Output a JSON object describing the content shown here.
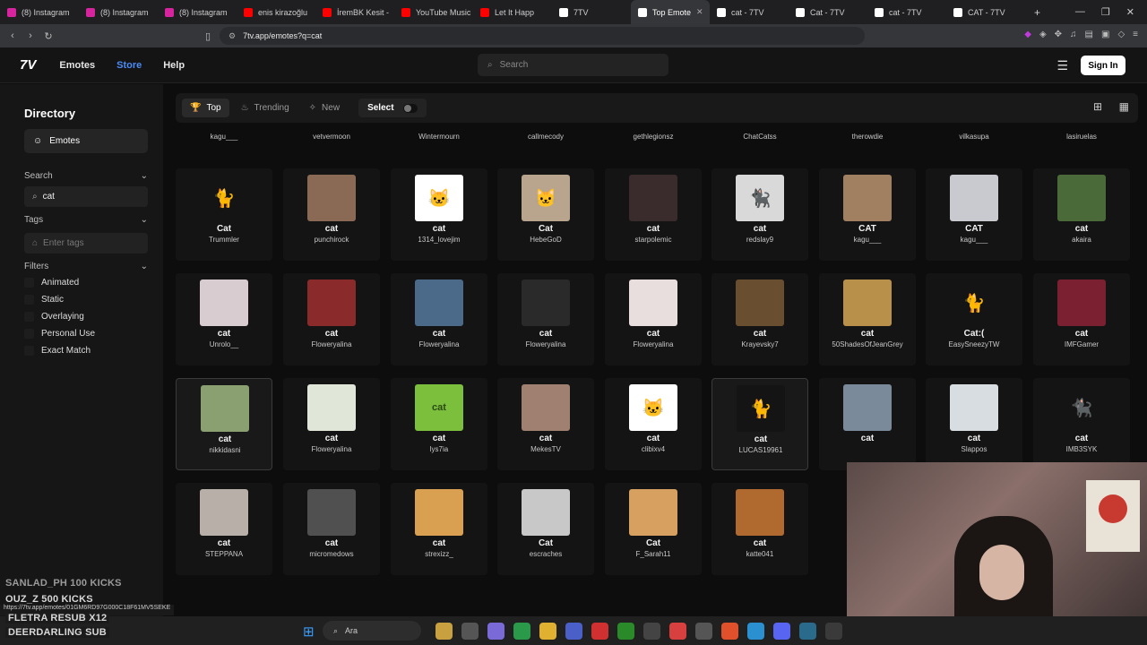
{
  "browser": {
    "tabs": [
      {
        "label": "(8) Instagram",
        "color": "#d6249f"
      },
      {
        "label": "(8) Instagram",
        "color": "#d6249f"
      },
      {
        "label": "(8) Instagram",
        "color": "#d6249f"
      },
      {
        "label": "enis kirazoğlu",
        "color": "#ff0000"
      },
      {
        "label": "İremBK Kesit -",
        "color": "#ff0000"
      },
      {
        "label": "YouTube Music",
        "color": "#ff0000"
      },
      {
        "label": "Let It Happ",
        "color": "#ff0000"
      },
      {
        "label": "7TV",
        "color": "#ffffff"
      },
      {
        "label": "Top Emote",
        "color": "#ffffff",
        "active": true
      },
      {
        "label": "cat - 7TV",
        "color": "#ffffff"
      },
      {
        "label": "Cat - 7TV",
        "color": "#ffffff"
      },
      {
        "label": "cat - 7TV",
        "color": "#ffffff"
      },
      {
        "label": "CAT - 7TV",
        "color": "#ffffff"
      }
    ],
    "url": "7tv.app/emotes?q=cat",
    "status_url": "https://7tv.app/emotes/01GM6RD97G000C18F61MV5SEKE"
  },
  "header": {
    "logo": "7V",
    "nav": [
      "Emotes",
      "Store",
      "Help"
    ],
    "search_placeholder": "Search",
    "sign_in": "Sign In"
  },
  "sidebar": {
    "title": "Directory",
    "emotes_label": "Emotes",
    "search_label": "Search",
    "search_value": "cat",
    "tags_label": "Tags",
    "tags_placeholder": "Enter tags",
    "filters_label": "Filters",
    "filters": [
      "Animated",
      "Static",
      "Overlaying",
      "Personal Use",
      "Exact Match"
    ]
  },
  "toolbar": {
    "top": "Top",
    "trending": "Trending",
    "new": "New",
    "select": "Select"
  },
  "grid": {
    "prev_row_owners": [
      "kagu___",
      "vetvermoon",
      "Wintermourn",
      "callmecody",
      "gethlegionsz",
      "ChatCatss",
      "therowdie",
      "vilkasupa",
      "lasiruelas"
    ],
    "rows": [
      [
        {
          "name": "Cat",
          "owner": "Trummler",
          "bg": "#141414",
          "glyph": "🐈",
          "tint": "#e0b040"
        },
        {
          "name": "cat",
          "owner": "punchirock",
          "bg": "#8a6a55",
          "glyph": "",
          "tint": ""
        },
        {
          "name": "cat",
          "owner": "1314_lovejim",
          "bg": "#ffffff",
          "glyph": "🐱",
          "tint": ""
        },
        {
          "name": "Cat",
          "owner": "HebeGoD",
          "bg": "#b9a48e",
          "glyph": "🐱",
          "tint": ""
        },
        {
          "name": "cat",
          "owner": "starpolemic",
          "bg": "#3a2c2c",
          "glyph": "",
          "tint": ""
        },
        {
          "name": "cat",
          "owner": "redslay9",
          "bg": "#d9d9d9",
          "glyph": "🐈‍⬛",
          "tint": ""
        },
        {
          "name": "CAT",
          "owner": "kagu___",
          "bg": "#a08060",
          "glyph": "",
          "tint": ""
        },
        {
          "name": "CAT",
          "owner": "kagu___",
          "bg": "#c9c9d0",
          "glyph": "",
          "tint": ""
        },
        {
          "name": "cat",
          "owner": "akaira",
          "bg": "#4a6a3a",
          "glyph": "",
          "tint": ""
        }
      ],
      [
        {
          "name": "cat",
          "owner": "Unrolo__",
          "bg": "#d8ccd0",
          "glyph": "",
          "tint": ""
        },
        {
          "name": "cat",
          "owner": "Floweryalina",
          "bg": "#8a2a2a",
          "glyph": "",
          "tint": ""
        },
        {
          "name": "cat",
          "owner": "Floweryalina",
          "bg": "#4b6a8a",
          "glyph": "",
          "tint": ""
        },
        {
          "name": "cat",
          "owner": "Floweryalina",
          "bg": "#2a2a2a",
          "glyph": "",
          "tint": ""
        },
        {
          "name": "cat",
          "owner": "Floweryalina",
          "bg": "#e8dede",
          "glyph": "",
          "tint": ""
        },
        {
          "name": "cat",
          "owner": "Krayevsky7",
          "bg": "#6a4e30",
          "glyph": "",
          "tint": ""
        },
        {
          "name": "cat",
          "owner": "50ShadesOfJeanGrey",
          "bg": "#b8904a",
          "glyph": "",
          "tint": ""
        },
        {
          "name": "Cat:(",
          "owner": "EasySneezyTW",
          "bg": "#141414",
          "glyph": "🐈",
          "tint": "#f2a9e8"
        },
        {
          "name": "cat",
          "owner": "IMFGamer",
          "bg": "#7a2030",
          "glyph": "",
          "tint": ""
        }
      ],
      [
        {
          "name": "cat",
          "owner": "nikkidasni",
          "bg": "#8aa070",
          "glyph": "",
          "tint": "",
          "selected": true
        },
        {
          "name": "cat",
          "owner": "Floweryalina",
          "bg": "#e0e6d8",
          "glyph": "",
          "tint": ""
        },
        {
          "name": "cat",
          "owner": "lys7ia",
          "bg": "#7bbf3c",
          "glyph": "cat",
          "tint": "#2b4a12"
        },
        {
          "name": "cat",
          "owner": "MekesTV",
          "bg": "#a08070",
          "glyph": "",
          "tint": ""
        },
        {
          "name": "cat",
          "owner": "clibixv4",
          "bg": "#ffffff",
          "glyph": "🐱",
          "tint": ""
        },
        {
          "name": "cat",
          "owner": "LUCAS19961",
          "bg": "#141414",
          "glyph": "🐈",
          "tint": "#c9a078",
          "selected": true
        },
        {
          "name": "cat",
          "owner": "",
          "bg": "#7a8a9a",
          "glyph": "",
          "tint": ""
        },
        {
          "name": "cat",
          "owner": "Slappos",
          "bg": "#d8dde2",
          "glyph": "",
          "tint": ""
        },
        {
          "name": "cat",
          "owner": "IMB3SYK",
          "bg": "#141414",
          "glyph": "🐈‍⬛",
          "tint": ""
        }
      ],
      [
        {
          "name": "cat",
          "owner": "STEPPANA",
          "bg": "#b8b0a8",
          "glyph": "",
          "tint": ""
        },
        {
          "name": "cat",
          "owner": "micromedows",
          "bg": "#505050",
          "glyph": "",
          "tint": ""
        },
        {
          "name": "cat",
          "owner": "strexizz_",
          "bg": "#d8a050",
          "glyph": "",
          "tint": ""
        },
        {
          "name": "Cat",
          "owner": "escraches",
          "bg": "#c8c8c8",
          "glyph": "",
          "tint": ""
        },
        {
          "name": "Cat",
          "owner": "F_Sarah11",
          "bg": "#d8a060",
          "glyph": "",
          "tint": ""
        },
        {
          "name": "cat",
          "owner": "katte041",
          "bg": "#b06a30",
          "glyph": "",
          "tint": ""
        }
      ]
    ]
  },
  "stream_overlay": {
    "lines": [
      "SANLAD_PH  100 KICKS",
      "OUZ_Z  500 KICKS",
      "FLETRA  RESUB X12",
      "DEERDARLING  SUB"
    ]
  },
  "taskbar": {
    "search_label": "Ara"
  }
}
